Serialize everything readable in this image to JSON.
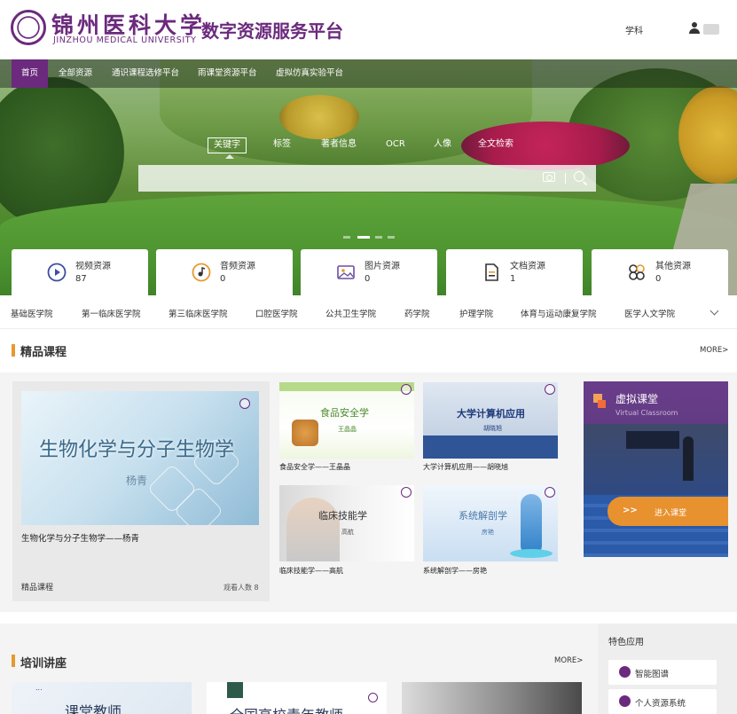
{
  "header": {
    "university_cn": "锦州医科大学",
    "university_en": "JINZHOU MEDICAL UNIVERSITY",
    "platform_title": "数字资源服务平台",
    "subject_link": "学科",
    "brand_color": "#6b2a7d"
  },
  "nav": {
    "items": [
      "首页",
      "全部资源",
      "通识课程选修平台",
      "雨课堂资源平台",
      "虚拟仿真实验平台"
    ]
  },
  "search": {
    "tabs": [
      "关键字",
      "标签",
      "著者信息",
      "OCR",
      "人像",
      "全文检索"
    ],
    "active_tab": "关键字",
    "value": ""
  },
  "resources": [
    {
      "label": "视频资源",
      "count": "87",
      "icon": "play-icon"
    },
    {
      "label": "音频资源",
      "count": "0",
      "icon": "music-note-icon"
    },
    {
      "label": "图片资源",
      "count": "0",
      "icon": "image-icon"
    },
    {
      "label": "文档资源",
      "count": "1",
      "icon": "document-icon"
    },
    {
      "label": "其他资源",
      "count": "0",
      "icon": "grid-icon"
    }
  ],
  "colleges": [
    "基础医学院",
    "第一临床医学院",
    "第三临床医学院",
    "口腔医学院",
    "公共卫生学院",
    "药学院",
    "护理学院",
    "体育与运动康复学院",
    "医学人文学院"
  ],
  "courses": {
    "section_title": "精品课程",
    "more": "MORE>",
    "featured": {
      "image_title": "生物化学与分子生物学",
      "image_subtitle": "杨青",
      "caption": "生物化学与分子生物学——杨青",
      "category": "精品课程",
      "views": "观看人数 8"
    },
    "items": [
      {
        "image_title": "食品安全学",
        "image_subtitle": "王晶晶",
        "caption": "食品安全学——王晶晶"
      },
      {
        "image_title": "大学计算机应用",
        "image_subtitle": "胡晓旭",
        "caption": "大学计算机应用——胡晓旭"
      },
      {
        "image_title": "临床技能学",
        "image_subtitle": "高航",
        "caption": "临床技能学——高航"
      },
      {
        "image_title": "系统解剖学",
        "image_subtitle": "房艳",
        "caption": "系统解剖学——房艳"
      }
    ]
  },
  "virtual_classroom": {
    "title": "虚拟课堂",
    "subtitle": "Virtual Classroom",
    "enter_label": "进入课堂",
    "arrows": ">>"
  },
  "training": {
    "section_title": "培训讲座",
    "more": "MORE>",
    "cards": [
      "...",
      "课堂教师",
      "全国高校青年教师"
    ]
  },
  "apps": {
    "title": "特色应用",
    "items": [
      {
        "label": "智能图谱",
        "icon": "graph-icon"
      },
      {
        "label": "个人资源系统",
        "icon": "person-icon"
      }
    ]
  },
  "colors": {
    "accent_orange": "#e69a2e",
    "enter_button": "#e8912f"
  }
}
